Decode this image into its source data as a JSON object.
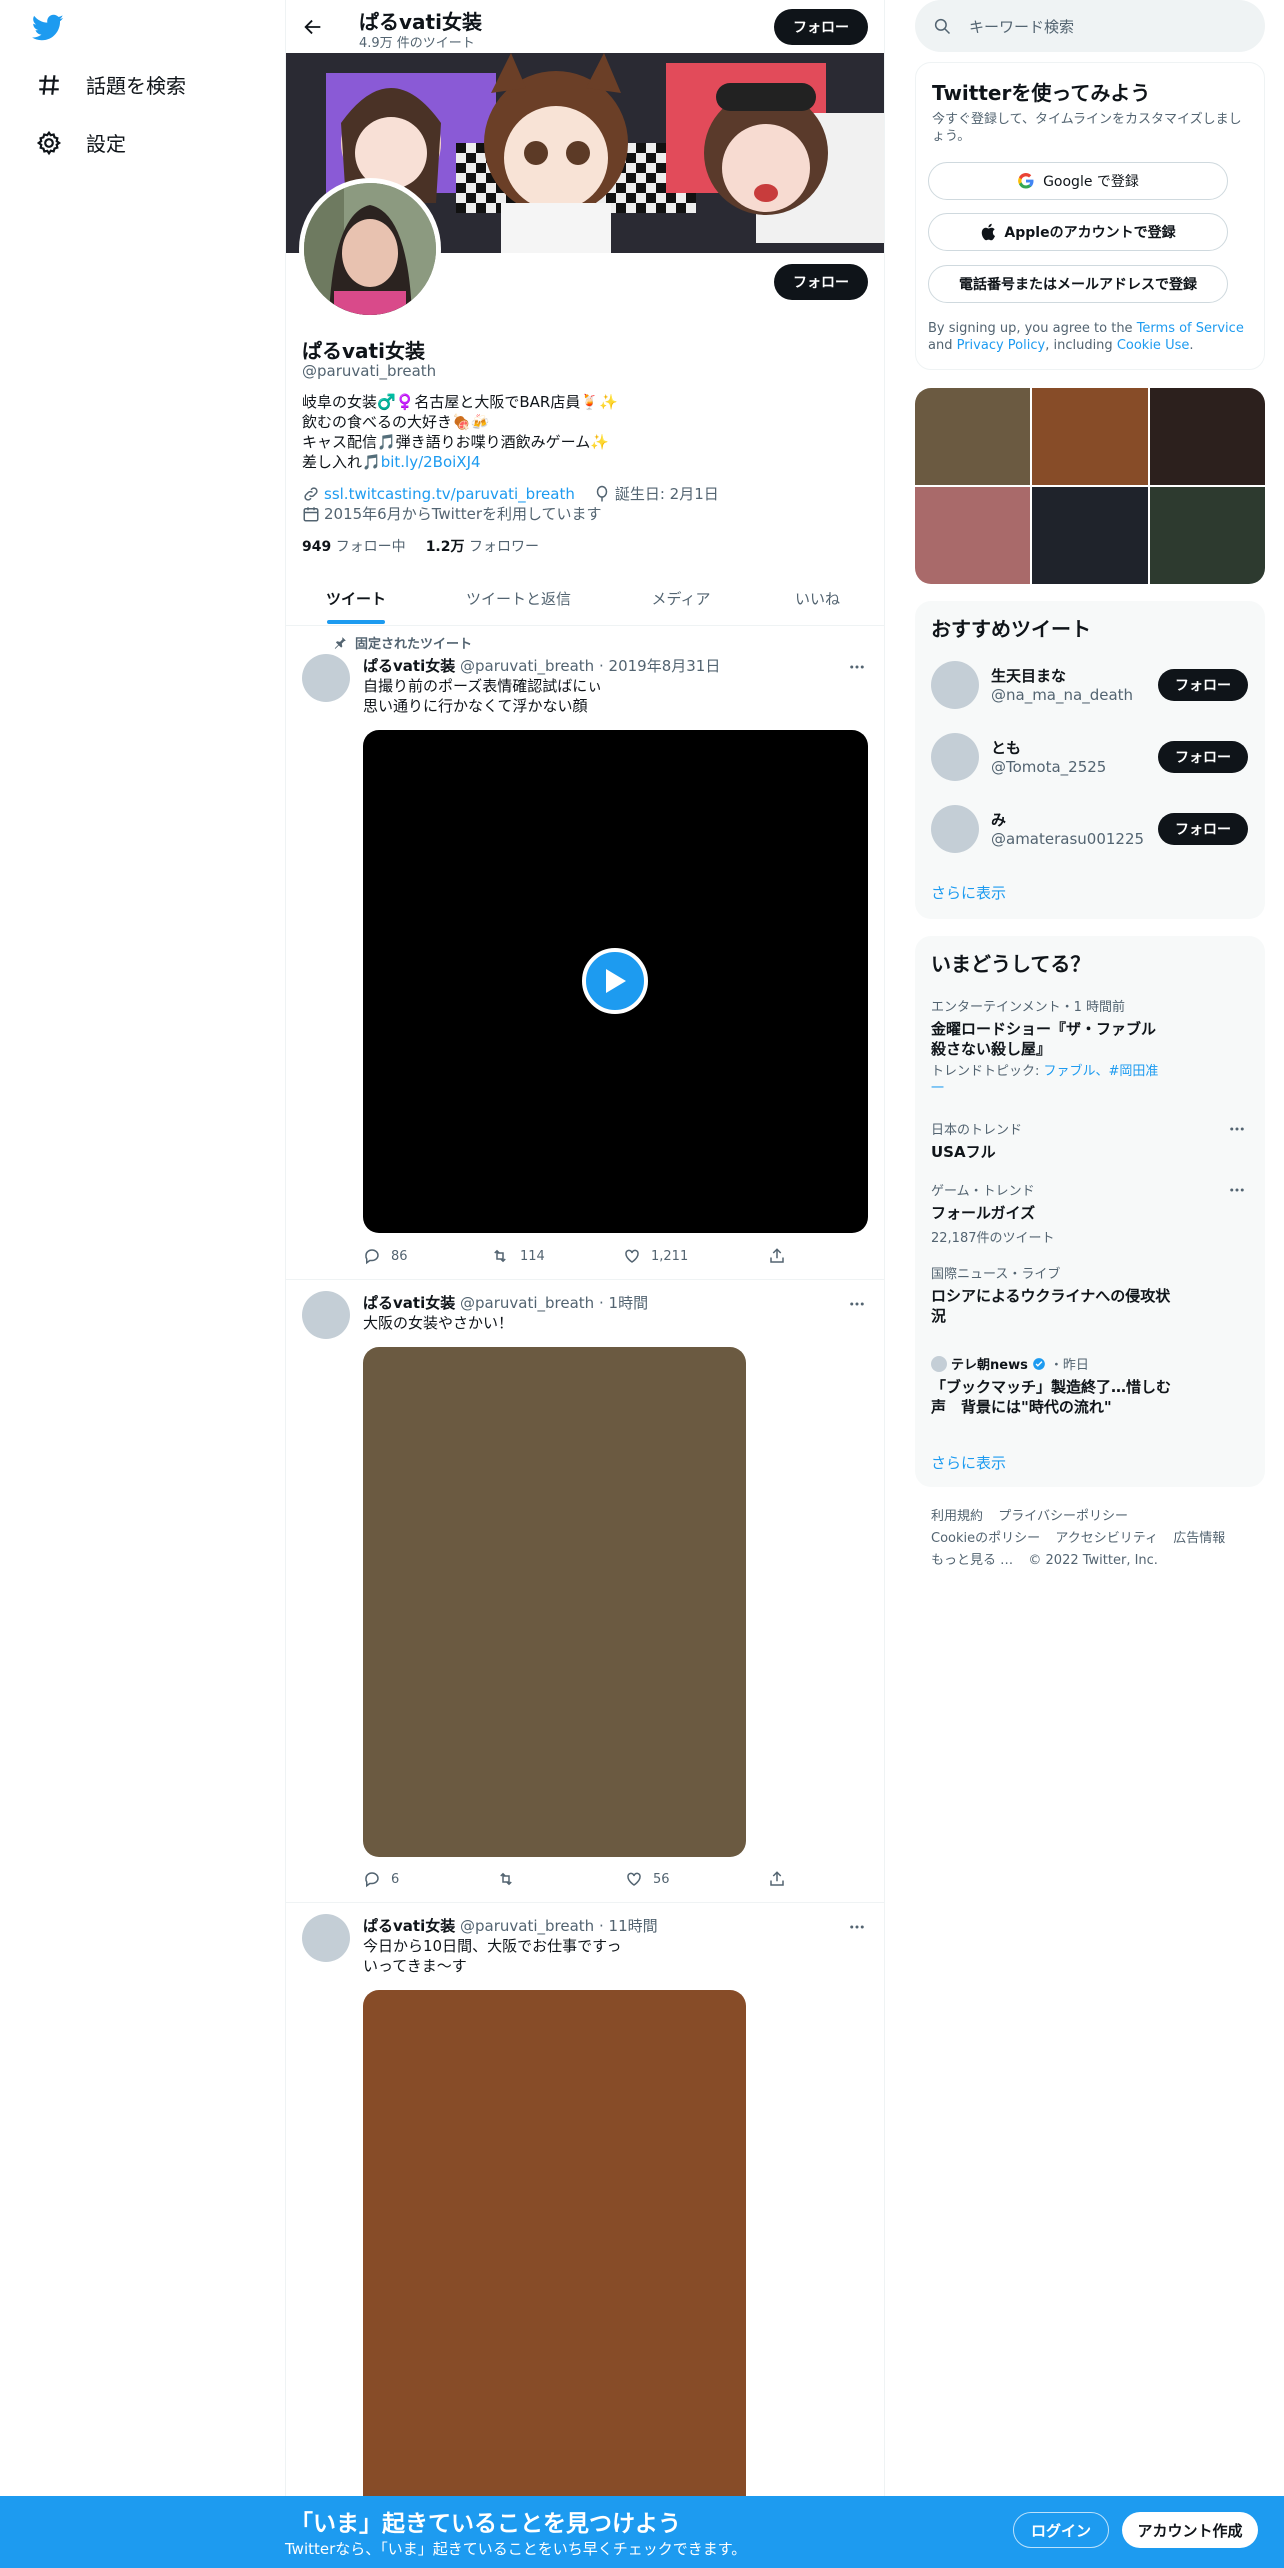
{
  "nav": {
    "explore_label": "話題を検索",
    "settings_label": "設定"
  },
  "header": {
    "name": "ぱるvati女装",
    "tweet_count": "4.9万 件のツイート",
    "follow_label": "フォロー"
  },
  "profile": {
    "name": "ぱるvati女装",
    "handle": "@paruvati_breath",
    "follow_label": "フォロー",
    "bio": [
      "岐阜の女装♂️♀️名古屋と大阪でBAR店員🍹✨",
      "飲むの食べるの大好き🍖🍻",
      "キャス配信🎵弾き語りお喋り酒飲みゲーム✨"
    ],
    "bio_last_prefix": "差し入れ🎵",
    "bio_link": "bit.ly/2BoiXJ4",
    "website": "ssl.twitcasting.tv/paruvati_breath",
    "birthday": "誕生日: 2月1日",
    "joined": "2015年6月からTwitterを利用しています",
    "following_count": "949",
    "following_label": "フォロー中",
    "followers_count": "1.2万",
    "followers_label": "フォロワー"
  },
  "tabs": [
    "ツイート",
    "ツイートと返信",
    "メディア",
    "いいね"
  ],
  "pinned_label": "固定されたツイート",
  "tweets": [
    {
      "name": "ぱるvati女装",
      "handle": "@paruvati_breath",
      "time": "2019年8月31日",
      "lines": [
        "自撮り前のポーズ表情確認試ばにぃ",
        "思い通りに行かなくて浮かない顔"
      ],
      "replies": "86",
      "retweets": "114",
      "likes": "1,211"
    },
    {
      "name": "ぱるvati女装",
      "handle": "@paruvati_breath",
      "time": "1時間",
      "lines": [
        "大阪の女装やさかい！"
      ],
      "replies": "6",
      "retweets": "",
      "likes": "56"
    },
    {
      "name": "ぱるvati女装",
      "handle": "@paruvati_breath",
      "time": "11時間",
      "lines": [
        "今日から10日間、大阪でお仕事ですっ",
        "いってきま～す"
      ]
    }
  ],
  "search": {
    "placeholder": "キーワード検索"
  },
  "signup": {
    "title": "Twitterを使ってみよう",
    "subtitle": "今すぐ登録して、タイムラインをカスタマイズしましょう。",
    "google": "Google で登録",
    "apple": "Appleのアカウントで登録",
    "phone": "電話番号またはメールアドレスで登録",
    "legal_1": "By signing up, you agree to the ",
    "terms": "Terms of Service",
    "legal_2": " and ",
    "privacy": "Privacy Policy",
    "legal_3": ", including ",
    "cookie": "Cookie Use",
    "legal_4": "."
  },
  "recommend": {
    "title": "おすすめツイート",
    "users": [
      {
        "name": "生天目まな",
        "handle": "@na_ma_na_death"
      },
      {
        "name": "とも",
        "handle": "@Tomota_2525"
      },
      {
        "name": "み",
        "handle": "@amaterasu001225"
      }
    ],
    "follow_label": "フォロー",
    "more": "さらに表示"
  },
  "trends": {
    "title": "いまどうしてる？",
    "items": [
      {
        "cat": "エンターテインメント・1 時間前",
        "name": "金曜ロードショー『ザ・ファブル 殺さない殺し屋』",
        "topic_prefix": "トレンドトピック: ",
        "topic_links": "ファブル、#岡田准一"
      },
      {
        "cat": "日本のトレンド",
        "name": "USAフル"
      },
      {
        "cat": "ゲーム・トレンド",
        "name": "フォールガイズ",
        "count": "22,187件のツイート"
      },
      {
        "cat": "国際ニュース・ライブ",
        "name": "ロシアによるウクライナへの侵攻状況"
      },
      {
        "source": "テレ朝news",
        "time": "・昨日",
        "name": "「ブックマッチ」製造終了…惜しむ声　背景には\"時代の流れ\""
      }
    ],
    "more": "さらに表示"
  },
  "footer": {
    "links": [
      "利用規約",
      "プライバシーポリシー",
      "Cookieのポリシー",
      "アクセシビリティ",
      "広告情報",
      "もっと見る …"
    ],
    "copyright": "© 2022 Twitter, Inc."
  },
  "bottom_bar": {
    "title": "「いま」起きていることを見つけよう",
    "subtitle": "Twitterなら、「いま」起きていることをいち早くチェックできます。",
    "login": "ログイン",
    "signup": "アカウント作成"
  },
  "colors": {
    "accent": "#1d9bf0",
    "media_2": "#6b5a41",
    "media_3": "#874c28"
  }
}
